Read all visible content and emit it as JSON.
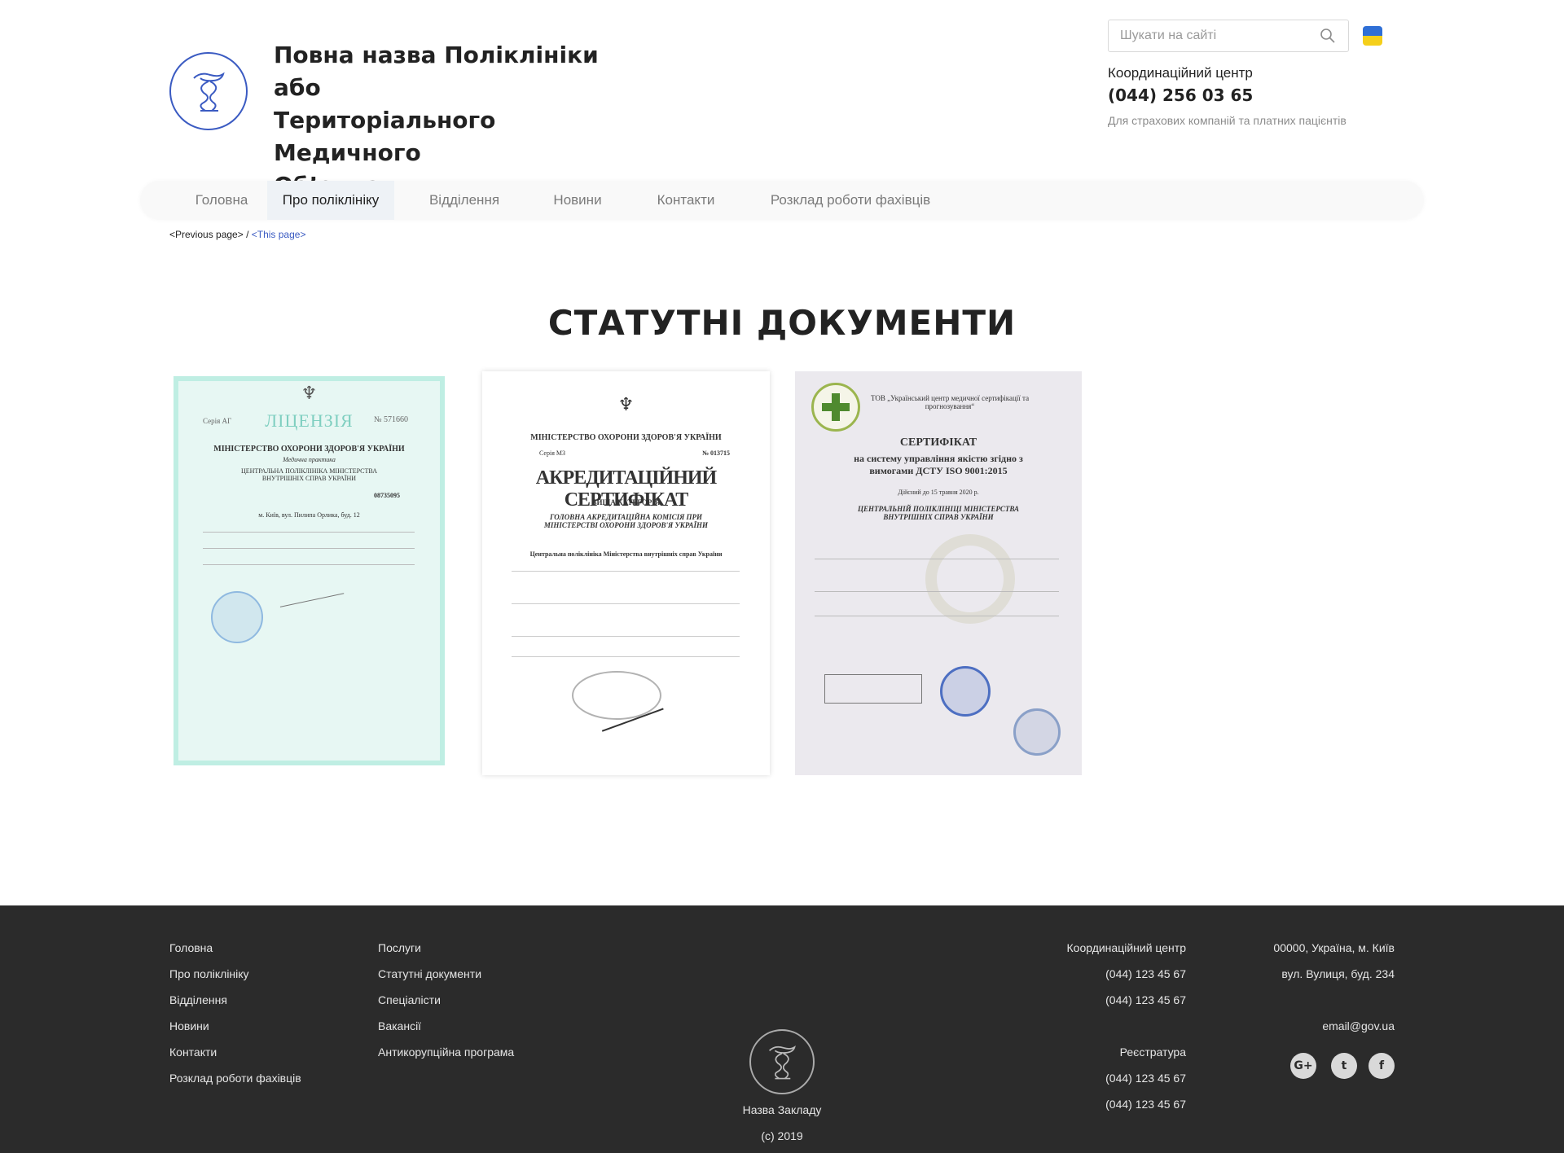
{
  "header": {
    "title_lines": [
      "Повна назва Поліклініки або",
      "Територіального Медичного",
      "Об’єднання"
    ],
    "search_placeholder": "Шукати на сайті",
    "coord_label": "Координаційний центр",
    "coord_phone": "(044) 256 03 65",
    "coord_note": "Для страхових компаній та платних пацієнтів",
    "flag_colors": [
      "#2f6fd6",
      "#f5cf1a"
    ],
    "accent_color": "#3b5bc2"
  },
  "nav": {
    "items": [
      {
        "label": "Головна",
        "active": false
      },
      {
        "label": "Про поліклініку",
        "active": true
      },
      {
        "label": "Відділення",
        "active": false
      },
      {
        "label": "Новини",
        "active": false
      },
      {
        "label": "Контакти",
        "active": false
      },
      {
        "label": "Розклад роботи фахівців",
        "active": false
      }
    ]
  },
  "breadcrumb": {
    "previous": "<Previous page>",
    "separator": " / ",
    "current": "<This page>"
  },
  "page": {
    "heading": "СТАТУТНІ ДОКУМЕНТИ"
  },
  "documents": [
    {
      "title": "ЛІЦЕНЗІЯ",
      "serial": "№ 571660",
      "series": "Серія АГ",
      "org": "МІНІСТЕРСТВО ОХОРОНИ ЗДОРОВ'Я УКРАЇНИ",
      "subtitle": "Медична практика",
      "holder": "ЦЕНТРАЛЬНА ПОЛІКЛІНІКА МІНІСТЕРСТВА ВНУТРІШНІХ СПРАВ УКРАЇНИ",
      "address": "м. Київ, вул. Пилипа Орлика, буд. 12",
      "code": "08735095"
    },
    {
      "org": "МІНІСТЕРСТВО ОХОРОНИ ЗДОРОВ'Я УКРАЇНИ",
      "series": "Серія МЗ",
      "serial": "№ 013715",
      "title": "АКРЕДИТАЦІЙНИЙ СЕРТИФІКАТ",
      "category": "ВИЩА КАТЕГОРІЯ",
      "commission": "ГОЛОВНА АКРЕДИТАЦІЙНА КОМІСІЯ ПРИ МІНІСТЕРСТВІ ОХОРОНИ ЗДОРОВ'Я УКРАЇНИ",
      "holder": "Центральна поліклініка Міністерства внутрішніх справ України"
    },
    {
      "issuer": "ТОВ „Український центр медичної сертифікації та прогнозування“",
      "title": "СЕРТИФІКАТ",
      "subtitle": "на систему управління якістю згідно з вимогами ДСТУ ISO 9001:2015",
      "valid": "Дійсний до 15 травня 2020 р.",
      "holder": "ЦЕНТРАЛЬНІЙ ПОЛІКЛІНІЦІ МІНІСТЕРСТВА ВНУТРІШНІХ СПРАВ УКРАЇНИ"
    }
  ],
  "footer": {
    "col1": [
      "Головна",
      "Про поліклініку",
      "Відділення",
      "Новини",
      "Контакти",
      "Розклад роботи фахівців"
    ],
    "col2": [
      "Послуги",
      "Статутні документи",
      "Спеціалісти",
      "Вакансії",
      "Антикорупційна програма"
    ],
    "coord_label": "Координаційний центр",
    "coord_phones": [
      "(044) 123 45 67",
      "(044) 123 45 67"
    ],
    "reg_label": "Реєстратура",
    "reg_phones": [
      "(044) 123 45 67",
      "(044) 123 45 67"
    ],
    "address_lines": [
      "00000, Україна, м. Київ",
      "вул. Вулиця, буд. 234"
    ],
    "email": "email@gov.ua",
    "name": "Назва Закладу",
    "copyright": "(c) 2019",
    "social": [
      {
        "icon": "google-plus-icon",
        "glyph": "G+"
      },
      {
        "icon": "twitter-icon",
        "glyph": "t"
      },
      {
        "icon": "facebook-icon",
        "glyph": "f"
      }
    ]
  }
}
